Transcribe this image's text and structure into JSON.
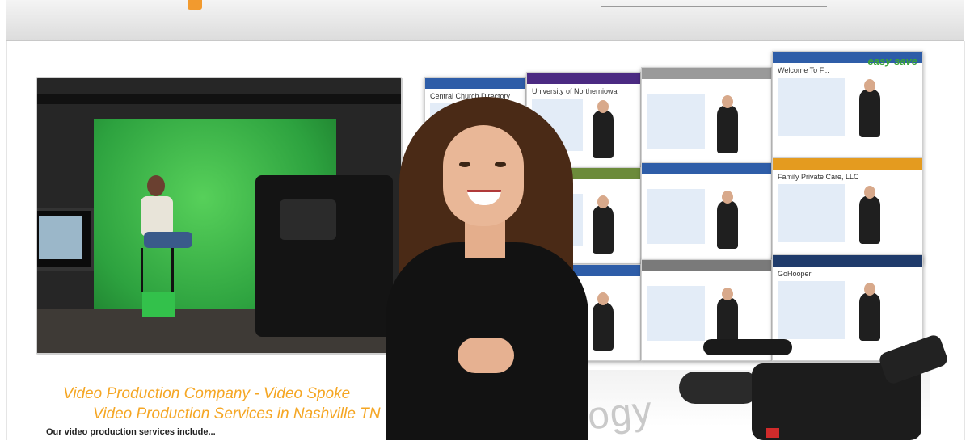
{
  "headings": {
    "caption_line1": "Video Production Company - Video Spoke",
    "caption_line2": "Video Production Services in Nashville TN",
    "services_intro": "Our video production services include..."
  },
  "background_text": {
    "watermark": "nology"
  },
  "showcase_tiles": [
    {
      "name": "central-church-directory",
      "title": "Central Church Directory",
      "accent": "#2e5da8"
    },
    {
      "name": "university-of-northerniowa",
      "title": "University of Northerniowa",
      "accent": "#4b2a82"
    },
    {
      "name": "motorcycle-chopper",
      "title": "",
      "accent": "#9a9a9a"
    },
    {
      "name": "easy-save",
      "title": "Welcome To F...",
      "accent": "#2e5da8",
      "headline": "easy save"
    },
    {
      "name": "web-spokesperson-1",
      "title": "",
      "accent": "#2e5da8"
    },
    {
      "name": "web-spokesperson-2",
      "title": "",
      "accent": "#6c8b3a"
    },
    {
      "name": "web-spokesperson-3",
      "title": "",
      "accent": "#2e5da8"
    },
    {
      "name": "family-private-care",
      "title": "Family Private Care, LLC",
      "accent": "#e49b1f"
    },
    {
      "name": "web-spokesperson-4",
      "title": "",
      "accent": "#2e5da8"
    },
    {
      "name": "web-spokesperson-5",
      "title": "",
      "accent": "#2e5da8"
    },
    {
      "name": "web-spokesperson-6",
      "title": "",
      "accent": "#7a7a7a"
    },
    {
      "name": "gohooper",
      "title": "GoHooper",
      "accent": "#1f3b6b"
    }
  ],
  "colors": {
    "caption": "#f5a623",
    "greenscreen": "#2da23f"
  }
}
